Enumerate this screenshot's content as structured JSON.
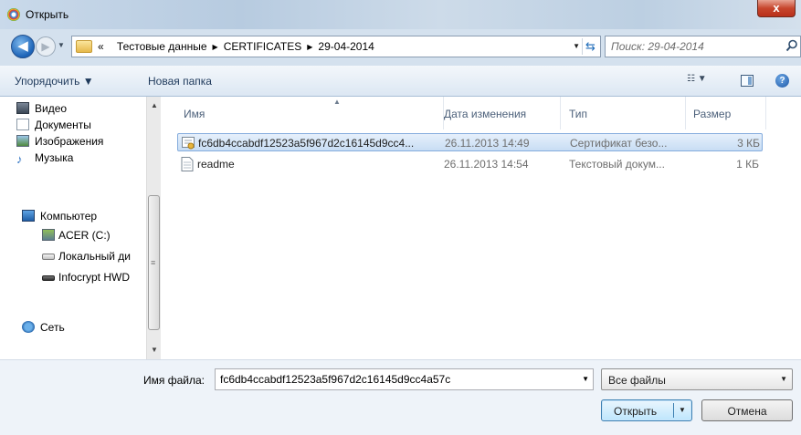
{
  "window": {
    "title": "Открыть",
    "close_label": "x"
  },
  "navigation": {
    "back_symbol": "◀",
    "forward_symbol": "▶",
    "breadcrumb_prefix": "«",
    "breadcrumbs": [
      "Тестовые данные",
      "CERTIFICATES",
      "29-04-2014"
    ],
    "search_placeholder": "Поиск: 29-04-2014"
  },
  "command_bar": {
    "organize": "Упорядочить ▼",
    "new_folder": "Новая папка"
  },
  "nav_pane": {
    "items": [
      {
        "label": "Видео",
        "icon": "video-icon"
      },
      {
        "label": "Документы",
        "icon": "documents-icon"
      },
      {
        "label": "Изображения",
        "icon": "pictures-icon"
      },
      {
        "label": "Музыка",
        "icon": "music-icon"
      },
      {
        "label": "Компьютер",
        "icon": "computer-icon"
      },
      {
        "label": "ACER (C:)",
        "icon": "drive-icon"
      },
      {
        "label": "Локальный ди",
        "icon": "drive-icon"
      },
      {
        "label": "Infocrypt HWD",
        "icon": "drive-icon"
      },
      {
        "label": "Сеть",
        "icon": "network-icon"
      }
    ]
  },
  "columns": {
    "name": "Имя",
    "date": "Дата изменения",
    "type": "Тип",
    "size": "Размер"
  },
  "files": [
    {
      "name": "fc6db4ccabdf12523a5f967d2c16145d9cc4...",
      "date": "26.11.2013 14:49",
      "type": "Сертификат безо...",
      "size": "3 КБ",
      "icon": "certificate-icon",
      "selected": true
    },
    {
      "name": "readme",
      "date": "26.11.2013 14:54",
      "type": "Текстовый докум...",
      "size": "1 КБ",
      "icon": "text-file-icon",
      "selected": false
    }
  ],
  "footer": {
    "filename_label": "Имя файла:",
    "filename_value": "fc6db4ccabdf12523a5f967d2c16145d9cc4a57c",
    "filetype": "Все файлы",
    "open_label": "Открыть",
    "cancel_label": "Отмена"
  },
  "colors": {
    "accent": "#3c7fb1",
    "selection": "#c8ddf4",
    "titlebar": "#c9d9ea"
  }
}
